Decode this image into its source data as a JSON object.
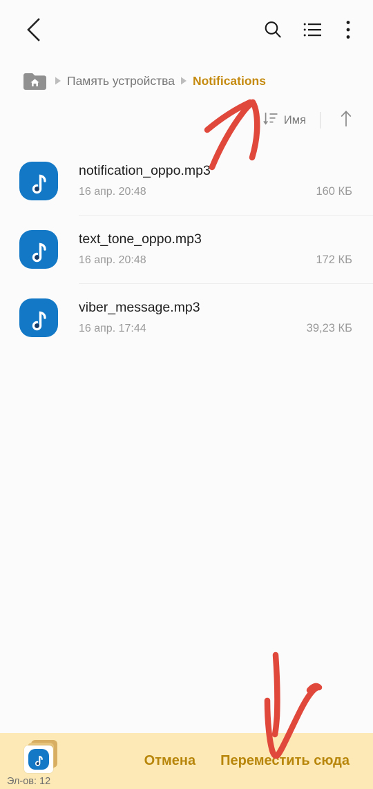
{
  "appbar": {
    "back_icon": "chevron-left-icon",
    "search_icon": "search-icon",
    "list_view_icon": "list-view-icon",
    "overflow_icon": "more-vertical-icon"
  },
  "breadcrumb": {
    "home_icon": "home-folder-icon",
    "separator": "triangle-right-icon",
    "items": [
      {
        "label": "Память устройства",
        "current": false
      },
      {
        "label": "Notifications",
        "current": true
      }
    ]
  },
  "sortbar": {
    "sort_icon": "sort-descending-icon",
    "sort_label": "Имя",
    "direction_icon": "arrow-up-icon"
  },
  "files": [
    {
      "name": "notification_oppo.mp3",
      "date": "16 апр. 20:48",
      "size": "160 КБ",
      "icon": "music-file-icon"
    },
    {
      "name": "text_tone_oppo.mp3",
      "date": "16 апр. 20:48",
      "size": "172 КБ",
      "icon": "music-file-icon"
    },
    {
      "name": "viber_message.mp3",
      "date": "16 апр. 17:44",
      "size": "39,23 КБ",
      "icon": "music-file-icon"
    }
  ],
  "bottombar": {
    "clipboard_icon": "clipboard-stack-icon",
    "count_label": "Эл-ов: 12",
    "cancel_label": "Отмена",
    "paste_label": "Переместить сюда"
  },
  "annotations": [
    {
      "name": "arrow-to-notifications",
      "color": "#E1483C"
    },
    {
      "name": "arrow-to-move-here",
      "color": "#E1483C"
    }
  ],
  "colors": {
    "accent": "#C58A10",
    "file_icon_blue": "#1379C6",
    "bottom_bar_bg": "#FCE9B6",
    "annotation_red": "#E1483C",
    "page_bg": "#FBFBFB"
  }
}
